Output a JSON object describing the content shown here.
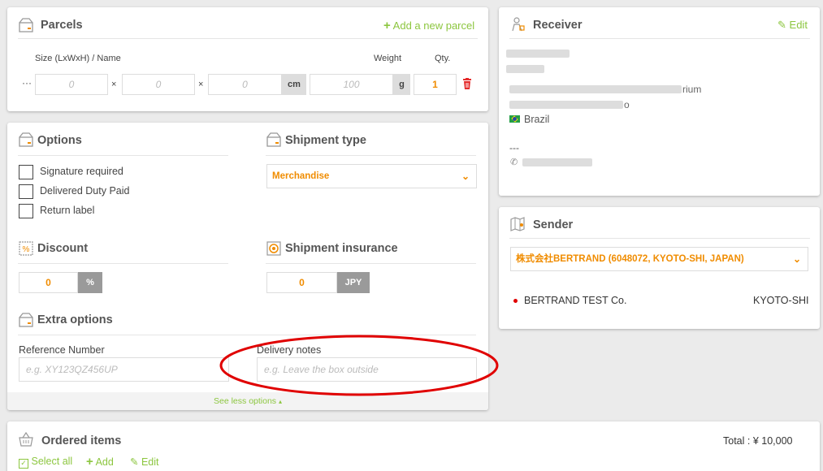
{
  "parcels": {
    "title": "Parcels",
    "add_label": "Add a new parcel",
    "size_header": "Size (LxWxH) / Name",
    "weight_header": "Weight",
    "qty_header": "Qty.",
    "dots": "···",
    "length_ph": "0",
    "width_ph": "0",
    "height_ph": "0",
    "times": "×",
    "cm": "cm",
    "weight_ph": "100",
    "g": "g",
    "qty_value": "1"
  },
  "options": {
    "title": "Options",
    "items": [
      "Signature required",
      "Delivered Duty Paid",
      "Return label"
    ]
  },
  "shipment_type": {
    "title": "Shipment type",
    "value": "Merchandise"
  },
  "discount": {
    "title": "Discount",
    "value": "0",
    "unit": "%"
  },
  "insurance": {
    "title": "Shipment insurance",
    "value": "0",
    "unit": "JPY"
  },
  "extra": {
    "title": "Extra options",
    "ref_label": "Reference Number",
    "ref_placeholder": "e.g. XY123QZ456UP",
    "notes_label": "Delivery notes",
    "notes_placeholder": "e.g. Leave the box outside",
    "see_less": "See less options",
    "see_less_arrow": "▴"
  },
  "receiver": {
    "title": "Receiver",
    "edit_label": "Edit",
    "address_tail": "rium",
    "address_tail2": "o",
    "country": "Brazil",
    "dashes": "---"
  },
  "sender": {
    "title": "Sender",
    "selected": "株式会社BERTRAND (6048072, KYOTO-SHI, JAPAN)",
    "company": "BERTRAND TEST Co.",
    "city": "KYOTO-SHI"
  },
  "ordered": {
    "title": "Ordered items",
    "total": "Total : ¥ 10,000",
    "select_all": "Select all",
    "add": "Add",
    "edit": "Edit"
  },
  "colors": {
    "accent": "#8cc63f",
    "orange": "#f08c00",
    "delete": "#e52b2b",
    "annotation": "#e00000"
  }
}
